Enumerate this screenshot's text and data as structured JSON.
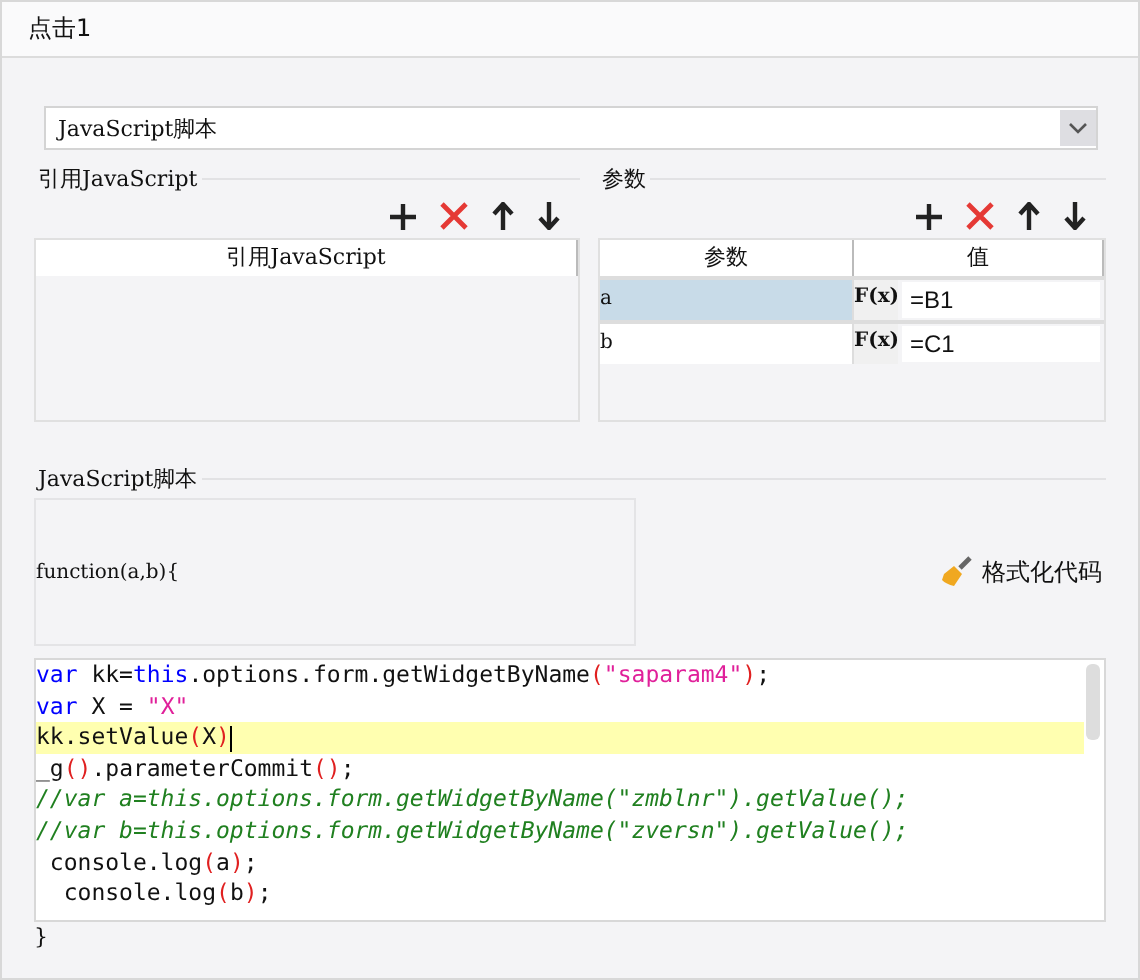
{
  "window": {
    "title": "点击1"
  },
  "script_type": {
    "value": "JavaScript脚本"
  },
  "ref_section": {
    "title": "引用JavaScript",
    "columns": [
      "引用JavaScript"
    ]
  },
  "param_section": {
    "title": "参数",
    "columns": [
      "参数",
      "值"
    ],
    "rows": [
      {
        "name": "a",
        "value": "=B1",
        "formula": "F(x)",
        "selected": true
      },
      {
        "name": "b",
        "value": "=C1",
        "formula": "F(x)",
        "selected": false
      }
    ]
  },
  "script_section": {
    "title": "JavaScript脚本",
    "header": "function(a,b){",
    "format_button": "格式化代码",
    "footer": "}"
  },
  "code_lines": [
    {
      "active": false,
      "tokens": [
        {
          "kind": "kw",
          "text": "var"
        },
        {
          "kind": "plain",
          "text": " kk="
        },
        {
          "kind": "kw",
          "text": "this"
        },
        {
          "kind": "plain",
          "text": ".options.form.getWidgetByName"
        },
        {
          "kind": "paren",
          "text": "("
        },
        {
          "kind": "str",
          "text": "\"saparam4\""
        },
        {
          "kind": "paren",
          "text": ")"
        },
        {
          "kind": "plain",
          "text": ";"
        }
      ]
    },
    {
      "active": false,
      "tokens": [
        {
          "kind": "kw",
          "text": "var"
        },
        {
          "kind": "plain",
          "text": " X = "
        },
        {
          "kind": "str",
          "text": "\"X\""
        }
      ]
    },
    {
      "active": true,
      "tokens": [
        {
          "kind": "plain",
          "text": "kk.setValue"
        },
        {
          "kind": "paren",
          "text": "("
        },
        {
          "kind": "plain",
          "text": "X"
        },
        {
          "kind": "paren",
          "text": ")"
        }
      ]
    },
    {
      "active": false,
      "tokens": [
        {
          "kind": "plain",
          "text": "_g"
        },
        {
          "kind": "paren",
          "text": "()"
        },
        {
          "kind": "plain",
          "text": ".parameterCommit"
        },
        {
          "kind": "paren",
          "text": "()"
        },
        {
          "kind": "plain",
          "text": ";"
        }
      ]
    },
    {
      "active": false,
      "tokens": [
        {
          "kind": "comment",
          "text": "//var a=this.options.form.getWidgetByName(\"zmblnr\").getValue();"
        }
      ]
    },
    {
      "active": false,
      "tokens": [
        {
          "kind": "comment",
          "text": "//var b=this.options.form.getWidgetByName(\"zversn\").getValue();"
        }
      ]
    },
    {
      "active": false,
      "tokens": [
        {
          "kind": "plain",
          "text": " console.log"
        },
        {
          "kind": "paren",
          "text": "("
        },
        {
          "kind": "plain",
          "text": "a"
        },
        {
          "kind": "paren",
          "text": ")"
        },
        {
          "kind": "plain",
          "text": ";"
        }
      ]
    },
    {
      "active": false,
      "tokens": [
        {
          "kind": "plain",
          "text": "  console.log"
        },
        {
          "kind": "paren",
          "text": "("
        },
        {
          "kind": "plain",
          "text": "b"
        },
        {
          "kind": "paren",
          "text": ")"
        },
        {
          "kind": "plain",
          "text": ";"
        }
      ]
    }
  ]
}
